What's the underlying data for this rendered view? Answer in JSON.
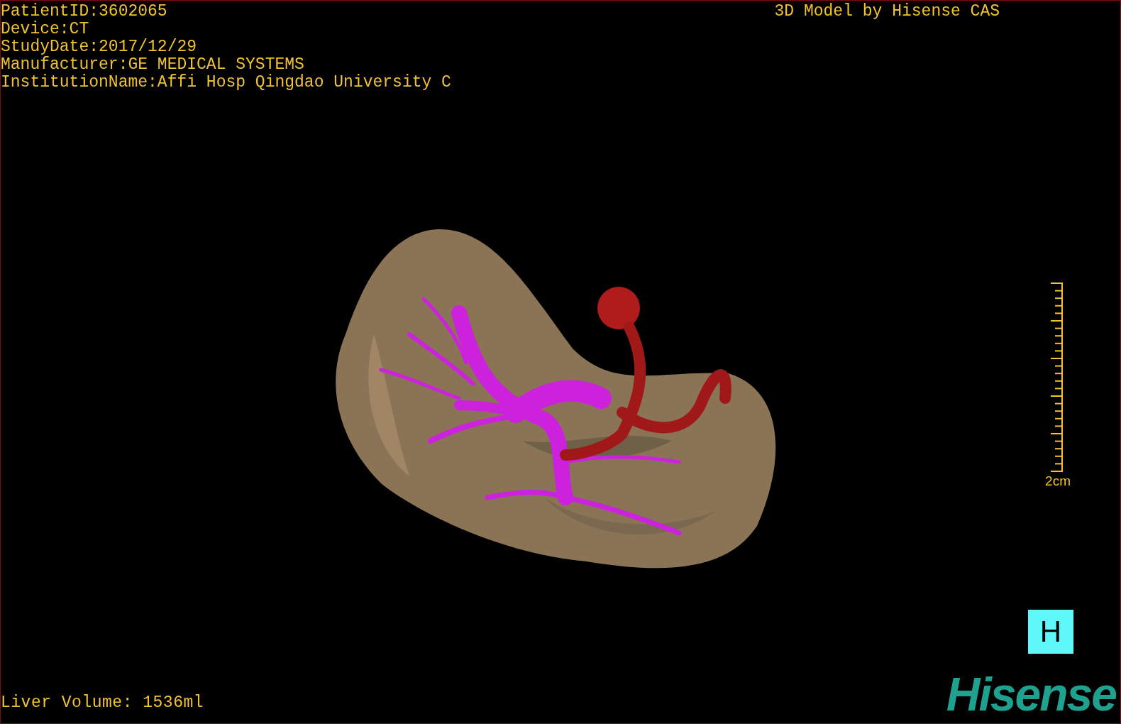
{
  "study_info": [
    "PatientID:3602065",
    "Device:CT",
    "StudyDate:2017/12/29",
    "Manufacturer:GE MEDICAL SYSTEMS",
    "InstitutionName:Affi Hosp Qingdao University C"
  ],
  "credit": "3D Model by Hisense CAS",
  "scale_bar": {
    "label": "2cm"
  },
  "orientation_marker": "H",
  "logo": "Hisense",
  "liver_volume": "Liver Volume: 1536ml"
}
